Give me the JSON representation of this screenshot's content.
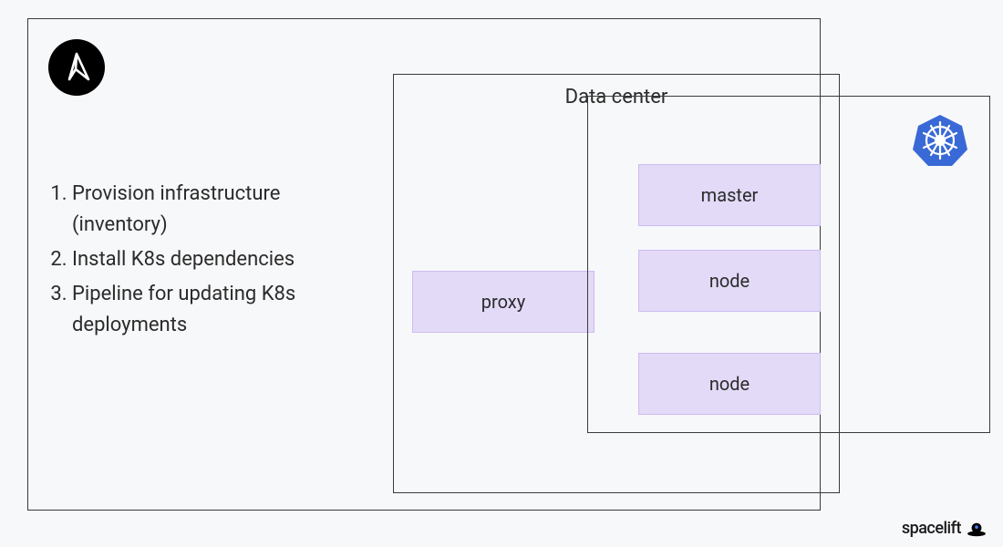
{
  "icons": {
    "ansible": "ansible-icon",
    "kubernetes": "kubernetes-icon",
    "brand": "spacelift-icon"
  },
  "steps": [
    "Provision infrastructure (inventory)",
    "Install K8s dependencies",
    "Pipeline for updating K8s deployments"
  ],
  "datacenter": {
    "title": "Data center",
    "proxy": "proxy",
    "nodes": [
      "master",
      "node",
      "node"
    ]
  },
  "brand": {
    "name": "spacelift"
  },
  "colors": {
    "node_bg": "#e3daf8",
    "node_border": "#cdbbf0",
    "k8s_blue": "#3969d6",
    "border": "#3a3a3a"
  }
}
